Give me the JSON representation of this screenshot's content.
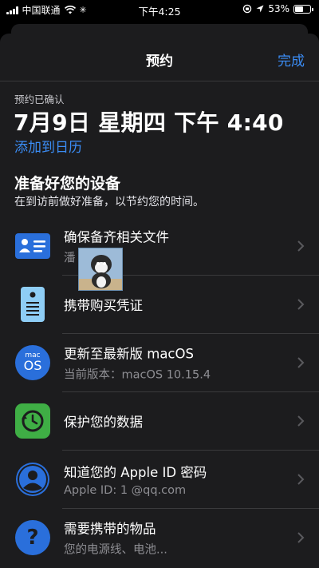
{
  "status_bar": {
    "carrier": "中国联通",
    "time": "下午4:25",
    "battery": "53%",
    "battery_level": 0.53
  },
  "nav": {
    "title": "预约",
    "done": "完成"
  },
  "appointment": {
    "confirmed_label": "预约已确认",
    "datetime": "7月9日 星期四 下午 4:40",
    "add_to_calendar": "添加到日历"
  },
  "prepare": {
    "heading": "准备好您的设备",
    "subtitle": "在到访前做好准备，以节约您的时间。"
  },
  "items": [
    {
      "title": "确保备齐相关文件",
      "subtitle": "潘      生/女士",
      "icon": "id-card-icon"
    },
    {
      "title": "携带购买凭证",
      "subtitle": "",
      "icon": "receipt-icon"
    },
    {
      "title": "更新至最新版 macOS",
      "subtitle": "当前版本：macOS 10.15.4",
      "icon": "macos-icon",
      "icon_text_top": "mac",
      "icon_text_bottom": "OS"
    },
    {
      "title": "保护您的数据",
      "subtitle": "",
      "icon": "backup-icon"
    },
    {
      "title": "知道您的 Apple ID 密码",
      "subtitle": "Apple ID: 1            @qq.com",
      "icon": "user-icon"
    },
    {
      "title": "需要携带的物品",
      "subtitle": "您的电源线、电池...",
      "icon": "question-icon",
      "icon_text": "?"
    }
  ],
  "colors": {
    "accent": "#3b8df6",
    "sheet_bg": "#1c1c1e",
    "icon_blue": "#2a6fdb",
    "icon_green": "#3fae45"
  }
}
